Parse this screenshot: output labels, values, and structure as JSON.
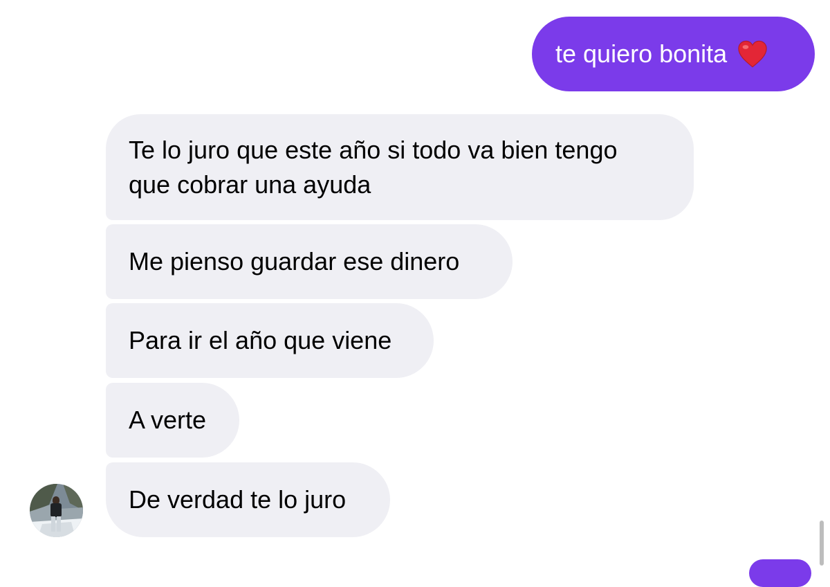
{
  "conversation": {
    "outgoing_messages": [
      {
        "text": "te quiero bonita",
        "emoji": "heart-icon"
      }
    ],
    "incoming_messages": [
      {
        "line1": "Te lo juro que este año si todo va bien tengo",
        "line2": "que cobrar una ayuda"
      },
      {
        "text": "Me pienso guardar ese dinero"
      },
      {
        "text": "Para ir el año que viene"
      },
      {
        "text": "A verte"
      },
      {
        "text": "De verdad te lo juro"
      }
    ]
  },
  "colors": {
    "outgoing_bubble": "#7b3bea",
    "incoming_bubble": "#efeff4",
    "background": "#ffffff"
  }
}
